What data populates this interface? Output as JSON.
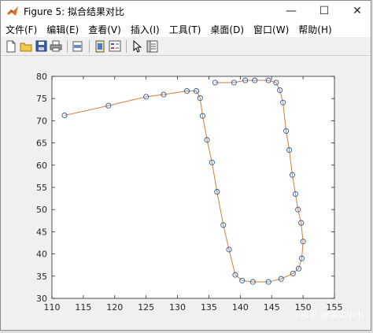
{
  "window": {
    "title": "Figure 5: 拟合结果对比",
    "minimize_glyph": "—",
    "maximize_glyph": "☐",
    "close_glyph": "✕"
  },
  "menu": [
    {
      "label": "文件(F)"
    },
    {
      "label": "编辑(E)"
    },
    {
      "label": "查看(V)"
    },
    {
      "label": "插入(I)"
    },
    {
      "label": "工具(T)"
    },
    {
      "label": "桌面(D)"
    },
    {
      "label": "窗口(W)"
    },
    {
      "label": "帮助(H)"
    }
  ],
  "toolbar": {
    "icons": [
      "new-figure-icon",
      "open-file-icon",
      "save-icon",
      "print-icon",
      "print-preview-icon",
      "link-plot-icon",
      "insert-legend-icon",
      "edit-plot-icon",
      "property-editor-icon"
    ]
  },
  "watermark": "知乎 @洛北小小",
  "chart_data": {
    "type": "line",
    "title": "",
    "xlabel": "",
    "ylabel": "",
    "xlim": [
      110,
      155
    ],
    "ylim": [
      30,
      80
    ],
    "x_ticks": [
      "110",
      "115",
      "120",
      "125",
      "130",
      "135",
      "140",
      "145",
      "150",
      "155"
    ],
    "y_ticks": [
      "30",
      "35",
      "40",
      "45",
      "50",
      "55",
      "60",
      "65",
      "70",
      "75",
      "80"
    ],
    "colors": {
      "line": "#d08a4a",
      "marker": "#2a5a9a"
    },
    "series": [
      {
        "style": "line",
        "x": [
          112.0,
          119.0,
          125.0,
          127.8,
          131.5,
          133.0,
          133.6,
          134.0,
          134.7,
          135.5,
          136.3,
          137.3,
          138.2,
          139.2,
          140.3,
          142.0,
          144.5,
          146.5,
          148.4,
          149.3,
          149.8,
          150.0,
          149.7,
          149.2,
          148.8,
          148.3,
          147.8,
          147.3,
          146.8,
          146.3,
          145.7,
          144.5,
          142.3,
          140.8,
          139.0,
          136.0
        ],
        "y": [
          71.2,
          73.4,
          75.4,
          75.9,
          76.7,
          76.7,
          75.1,
          71.1,
          65.7,
          60.6,
          54.0,
          46.5,
          41.0,
          35.3,
          34.0,
          33.7,
          33.7,
          34.4,
          35.6,
          36.7,
          39.0,
          42.8,
          47.0,
          50.0,
          53.5,
          57.8,
          63.4,
          67.7,
          74.1,
          76.9,
          78.6,
          79.1,
          79.1,
          79.1,
          78.6,
          78.6
        ]
      },
      {
        "style": "markers",
        "x": [
          112.0,
          119.0,
          125.0,
          127.8,
          131.5,
          133.0,
          133.6,
          134.0,
          134.7,
          135.5,
          136.3,
          137.3,
          138.2,
          139.2,
          140.3,
          142.0,
          144.5,
          146.5,
          148.4,
          149.3,
          149.8,
          150.0,
          149.7,
          149.2,
          148.8,
          148.3,
          147.8,
          147.3,
          146.8,
          146.3,
          145.7,
          144.5,
          142.3,
          140.8,
          139.0,
          136.0
        ],
        "y": [
          71.2,
          73.4,
          75.4,
          75.9,
          76.7,
          76.7,
          75.1,
          71.1,
          65.7,
          60.6,
          54.0,
          46.5,
          41.0,
          35.3,
          34.0,
          33.7,
          33.7,
          34.4,
          35.6,
          36.7,
          39.0,
          42.8,
          47.0,
          50.0,
          53.5,
          57.8,
          63.4,
          67.7,
          74.1,
          76.9,
          78.6,
          79.1,
          79.1,
          79.1,
          78.6,
          78.6
        ]
      }
    ]
  }
}
